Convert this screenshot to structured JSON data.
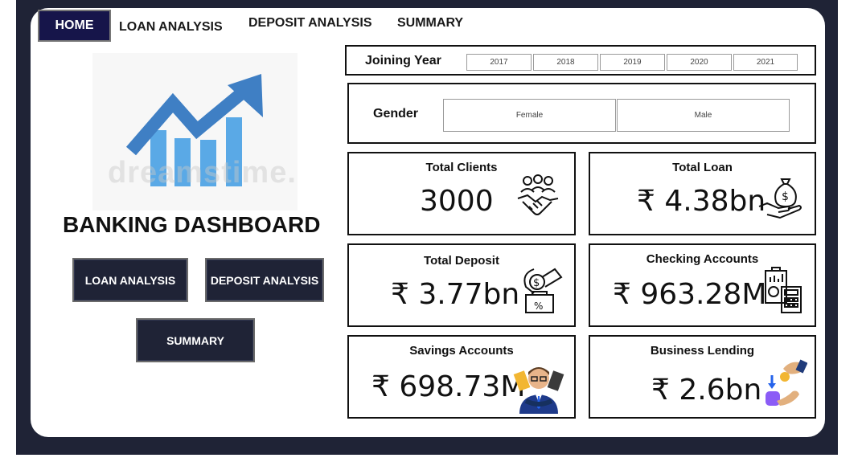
{
  "nav": {
    "home": "HOME",
    "loan_analysis": "LOAN ANALYSIS",
    "deposit_analysis": "DEPOSIT ANALYSIS",
    "summary": "SUMMARY"
  },
  "hero": {
    "watermark": "dreamstime.",
    "title": "BANKING DASHBOARD"
  },
  "buttons": {
    "loan_analysis": "LOAN ANALYSIS",
    "deposit_analysis": "DEPOSIT ANALYSIS",
    "summary": "SUMMARY"
  },
  "filters": {
    "joining_year": {
      "label": "Joining Year",
      "options": [
        "2017",
        "2018",
        "2019",
        "2020",
        "2021"
      ]
    },
    "gender": {
      "label": "Gender",
      "options": [
        "Female",
        "Male"
      ]
    }
  },
  "kpis": {
    "total_clients": {
      "title": "Total Clients",
      "value": "3000",
      "icon": "handshake-icon"
    },
    "total_loan": {
      "title": "Total Loan",
      "value": "₹ 4.38bn",
      "icon": "money-bag-icon"
    },
    "total_deposit": {
      "title": "Total Deposit",
      "value": "₹ 3.77bn",
      "icon": "deposit-icon"
    },
    "checking_accounts": {
      "title": "Checking Accounts",
      "value": "₹ 963.28M",
      "icon": "calculator-icon"
    },
    "savings_accounts": {
      "title": "Savings Accounts",
      "value": "₹ 698.73M",
      "icon": "banker-icon"
    },
    "business_lending": {
      "title": "Business Lending",
      "value": "₹ 2.6bn",
      "icon": "lending-icon"
    }
  },
  "colors": {
    "frame": "#1f2336",
    "home_button": "#16154a",
    "chart_blue": "#4a90d9",
    "chart_light_blue": "#5aa9e6"
  }
}
